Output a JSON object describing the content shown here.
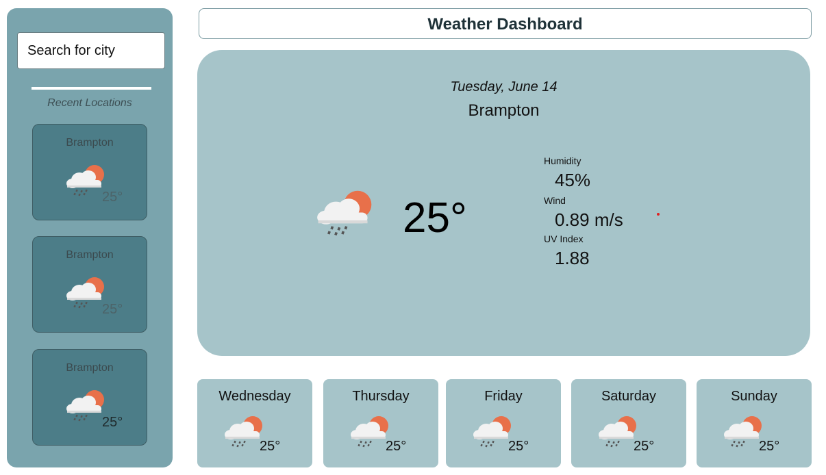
{
  "header": {
    "title": "Weather Dashboard"
  },
  "sidebar": {
    "search_placeholder": "Search for city",
    "recent_title": "Recent Locations",
    "recent": [
      {
        "city": "Brampton",
        "temp": "25°",
        "icon": "cloud-rain-sun-icon"
      },
      {
        "city": "Brampton",
        "temp": "25°",
        "icon": "cloud-rain-sun-icon"
      },
      {
        "city": "Brampton",
        "temp": "25°",
        "icon": "cloud-rain-sun-icon"
      }
    ]
  },
  "current": {
    "date": "Tuesday, June 14",
    "city": "Brampton",
    "temp": "25°",
    "icon": "cloud-rain-sun-icon",
    "humidity_label": "Humidity",
    "humidity": "45%",
    "wind_label": "Wind",
    "wind": "0.89 m/s",
    "uv_label": "UV Index",
    "uv": "1.88"
  },
  "forecast": [
    {
      "day": "Wednesday",
      "temp": "25°",
      "icon": "cloud-rain-sun-icon"
    },
    {
      "day": "Thursday",
      "temp": "25°",
      "icon": "cloud-rain-sun-icon"
    },
    {
      "day": "Friday",
      "temp": "25°",
      "icon": "cloud-rain-sun-icon"
    },
    {
      "day": "Saturday",
      "temp": "25°",
      "icon": "cloud-rain-sun-icon"
    },
    {
      "day": "Sunday",
      "temp": "25°",
      "icon": "cloud-rain-sun-icon"
    }
  ],
  "colors": {
    "sidebar": "#7aa4ad",
    "card_dark": "#4c7d88",
    "card_light": "#a6c4c9",
    "sun": "#e8704a"
  }
}
